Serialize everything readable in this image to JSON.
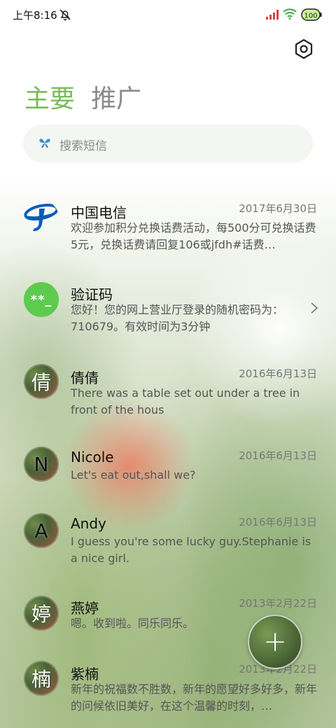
{
  "status_bar": {
    "time": "上午8:16",
    "battery_level": "100",
    "icons": [
      "do-not-disturb-icon",
      "signal-icon",
      "wifi-icon",
      "battery-icon"
    ]
  },
  "header": {
    "settings_icon": "gear-icon",
    "tabs": [
      {
        "label": "主要",
        "active": true
      },
      {
        "label": "推广",
        "active": false
      }
    ]
  },
  "search": {
    "placeholder": "搜索短信",
    "icon": "butterfly-icon"
  },
  "messages": [
    {
      "sender": "中国电信",
      "date": "2017年6月30日",
      "preview": "欢迎参加积分兑换话费活动，每500分可兑换话费5元，兑换话费请回复106或jfdh#话费…",
      "avatar": "china-telecom-logo"
    },
    {
      "sender": "验证码",
      "date": "",
      "preview": "您好！您的网上营业厅登录的随机密码为：710679。有效时间为3分钟",
      "avatar": "**_",
      "chevron": "chevron-right-icon"
    },
    {
      "sender": "倩倩",
      "date": "2016年6月13日",
      "preview": "There was a table set out under a tree in front of the hous",
      "avatar": "倩"
    },
    {
      "sender": "Nicole",
      "date": "2016年6月13日",
      "preview": "Let's eat out,shall we?",
      "avatar": "N"
    },
    {
      "sender": "Andy",
      "date": "2016年6月13日",
      "preview": "I guess you're some lucky guy.Stephanie is a nice girl.",
      "avatar": "A"
    },
    {
      "sender": "燕婷",
      "date": "2013年2月22日",
      "preview": "嗯。收到啦。同乐同乐。",
      "avatar": "婷"
    },
    {
      "sender": "紫楠",
      "date": "2013年2月22日",
      "preview": "新年的祝福数不胜数，新年的愿望好多好多，新年的问候依旧美好，在这个温馨的时刻，…",
      "avatar": "楠"
    }
  ],
  "fab": {
    "label": "+",
    "icon": "plus-icon"
  },
  "colors": {
    "accent": "#7cba5b",
    "telecom_blue": "#0a5cb8",
    "code_green": "#5ecb4f"
  }
}
